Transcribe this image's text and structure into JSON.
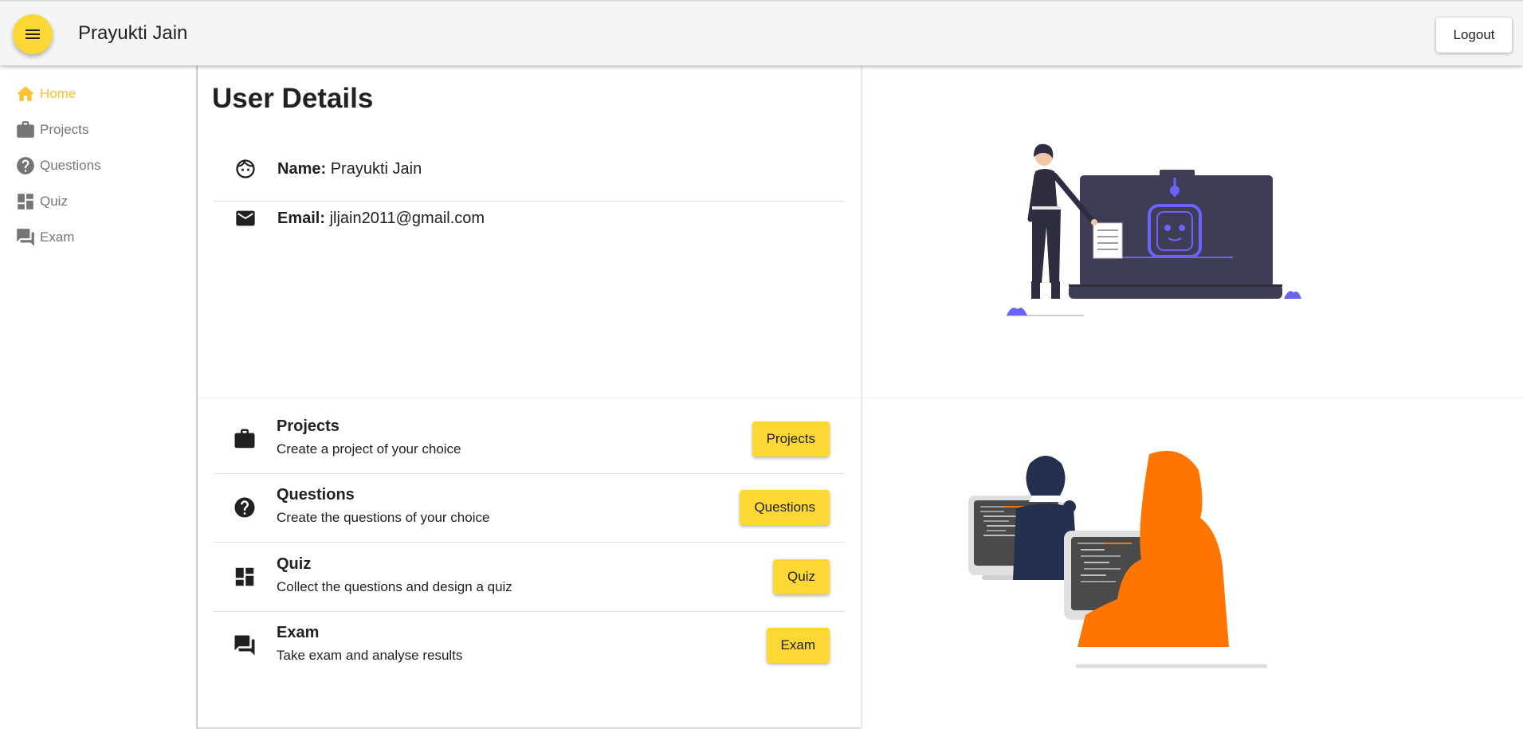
{
  "header": {
    "title": "Prayukti Jain",
    "logout_label": "Logout"
  },
  "sidebar": {
    "items": [
      {
        "label": "Home",
        "icon": "home-icon",
        "active": true
      },
      {
        "label": "Projects",
        "icon": "briefcase-icon",
        "active": false
      },
      {
        "label": "Questions",
        "icon": "help-circle-icon",
        "active": false
      },
      {
        "label": "Quiz",
        "icon": "dashboard-icon",
        "active": false
      },
      {
        "label": "Exam",
        "icon": "forum-icon",
        "active": false
      }
    ]
  },
  "user_details": {
    "title": "User Details",
    "name_label": "Name:",
    "name_value": "Prayukti Jain",
    "email_label": "Email:",
    "email_value": "jljain2011@gmail.com"
  },
  "features": [
    {
      "title": "Projects",
      "description": "Create a project of your choice",
      "button": "Projects",
      "icon": "briefcase-icon"
    },
    {
      "title": "Questions",
      "description": "Create the questions of your choice",
      "button": "Questions",
      "icon": "help-circle-icon"
    },
    {
      "title": "Quiz",
      "description": "Collect the questions and design a quiz",
      "button": "Quiz",
      "icon": "dashboard-icon"
    },
    {
      "title": "Exam",
      "description": "Take exam and analyse results",
      "button": "Exam",
      "icon": "forum-icon"
    }
  ],
  "colors": {
    "accent": "#fdd835",
    "active_nav": "#fbc02d",
    "illustration_purple": "#6c63ff",
    "illustration_orange": "#ff7500",
    "illustration_navy": "#25304f"
  }
}
